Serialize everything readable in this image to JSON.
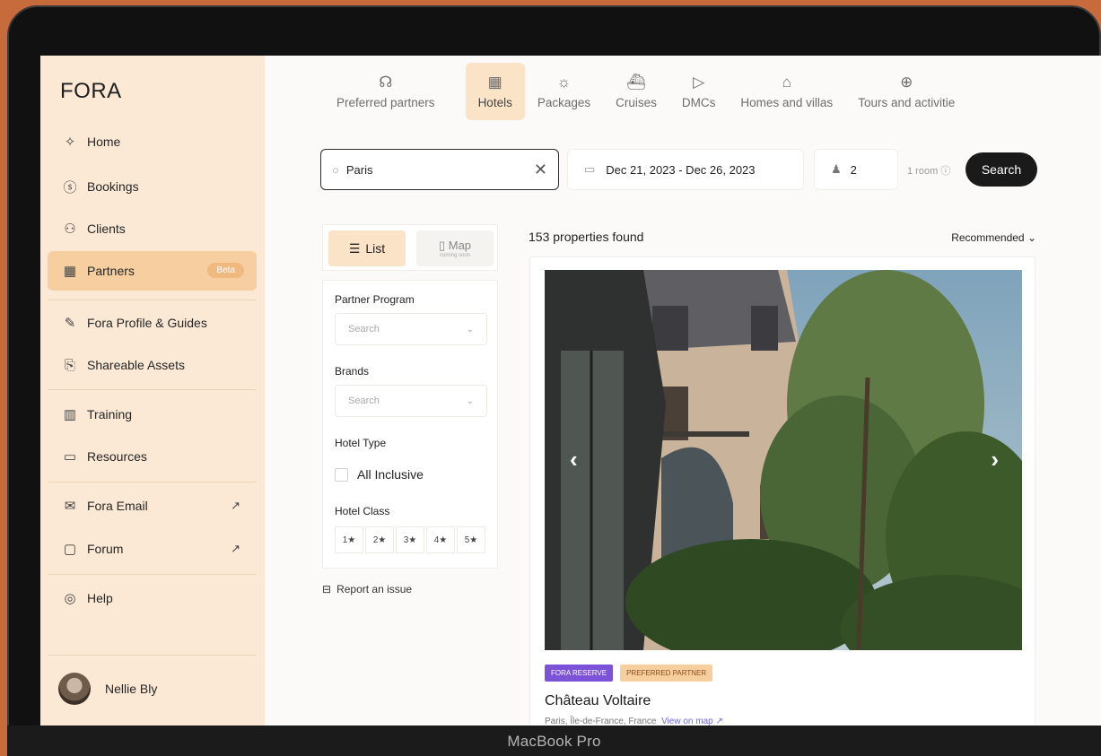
{
  "device_label": "MacBook Pro",
  "sidebar": {
    "logo": "FORA",
    "items": [
      {
        "label": "Home",
        "icon": "sparkle-icon"
      },
      {
        "label": "Bookings",
        "icon": "dollar-icon"
      },
      {
        "label": "Clients",
        "icon": "people-icon"
      },
      {
        "label": "Partners",
        "icon": "building-icon",
        "badge": "Beta",
        "active": true
      },
      {
        "label": "Fora Profile & Guides",
        "icon": "pencil-icon"
      },
      {
        "label": "Shareable Assets",
        "icon": "share-icon"
      },
      {
        "label": "Training",
        "icon": "book-icon"
      },
      {
        "label": "Resources",
        "icon": "folder-icon"
      },
      {
        "label": "Fora Email",
        "icon": "mail-icon"
      },
      {
        "label": "Forum",
        "icon": "chat-icon"
      },
      {
        "label": "Help",
        "icon": "lifebuoy-icon"
      }
    ],
    "user": {
      "name": "Nellie Bly"
    }
  },
  "tabs": [
    {
      "label": "Preferred partners",
      "icon": "handshake-icon"
    },
    {
      "label": "Hotels",
      "icon": "hotel-icon",
      "active": true
    },
    {
      "label": "Packages",
      "icon": "sunset-icon"
    },
    {
      "label": "Cruises",
      "icon": "ship-icon"
    },
    {
      "label": "DMCs",
      "icon": "send-icon"
    },
    {
      "label": "Homes and villas",
      "icon": "home-icon"
    },
    {
      "label": "Tours and activitie",
      "icon": "globe-icon"
    }
  ],
  "search": {
    "destination": "Paris",
    "dates": "Dec 21, 2023 - Dec 26, 2023",
    "guests": "2",
    "rooms": "1 room",
    "button": "Search"
  },
  "view": {
    "list": "List",
    "map": "Map",
    "map_sub": "coming soon"
  },
  "filters": {
    "partner_program": "Partner Program",
    "partner_placeholder": "Search",
    "brands": "Brands",
    "brands_placeholder": "Search",
    "hotel_type": "Hotel Type",
    "all_inclusive": "All Inclusive",
    "hotel_class": "Hotel Class",
    "stars": [
      "1★",
      "2★",
      "3★",
      "4★",
      "5★"
    ]
  },
  "report": "Report an issue",
  "results": {
    "count": "153 properties found",
    "sort": "Recommended",
    "hotel": {
      "badge1": "FORA RESERVE",
      "badge2": "PREFERRED PARTNER",
      "name": "Château Voltaire",
      "location": "Paris, Île-de-France, France",
      "map_link": "View on map"
    }
  }
}
